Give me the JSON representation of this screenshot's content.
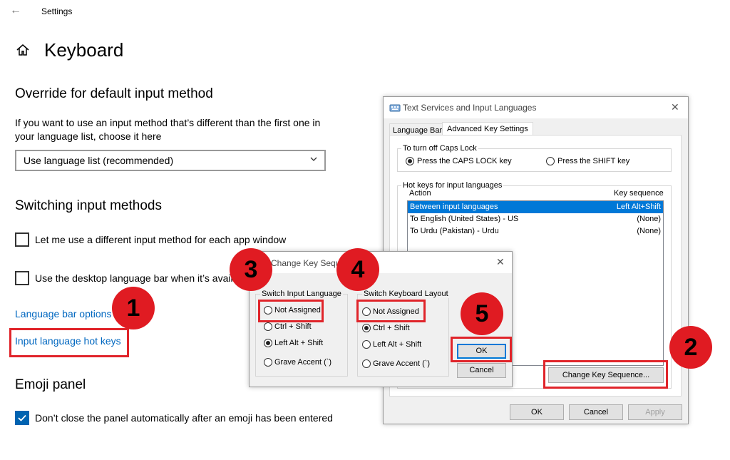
{
  "window": {
    "back_icon": "back-arrow-icon",
    "title": "Settings"
  },
  "page": {
    "title": "Keyboard",
    "home_icon": "home-icon"
  },
  "override": {
    "heading": "Override for default input method",
    "description_line1": "If you want to use an input method that’s different than the first one in",
    "description_line2": "your language list, choose it here",
    "dropdown_value": "Use language list (recommended)"
  },
  "switching": {
    "heading": "Switching input methods",
    "option1": "Let me use a different input method for each app window",
    "option2": "Use the desktop language bar when it’s available",
    "link_language_bar": "Language bar options",
    "link_hotkeys": "Input language hot keys"
  },
  "emoji": {
    "heading": "Emoji panel",
    "option": "Don’t close the panel automatically after an emoji has been entered"
  },
  "tsil": {
    "title": "Text Services and Input Languages",
    "close": "✕",
    "tabs": [
      "Language Bar",
      "Advanced Key Settings"
    ],
    "caps_group": "To turn off Caps Lock",
    "caps_opt1": "Press the CAPS LOCK key",
    "caps_opt2": "Press the SHIFT key",
    "hotkeys_group": "Hot keys for input languages",
    "col_action": "Action",
    "col_sequence": "Key sequence",
    "rows": [
      {
        "action": "Between input languages",
        "sequence": "Left Alt+Shift"
      },
      {
        "action": "To English (United States) - US",
        "sequence": "(None)"
      },
      {
        "action": "To Urdu (Pakistan) - Urdu",
        "sequence": "(None)"
      }
    ],
    "change_btn": "Change Key Sequence...",
    "ok": "OK",
    "cancel": "Cancel",
    "apply": "Apply"
  },
  "cks": {
    "title": "Change Key Seque",
    "close": "✕",
    "input_group": "Switch Input Language",
    "input_opts": [
      "Not Assigned",
      "Ctrl + Shift",
      "Left Alt + Shift",
      "Grave Accent (`)"
    ],
    "layout_group": "Switch Keyboard Layout",
    "layout_opts": [
      "Not Assigned",
      "Ctrl + Shift",
      "Left Alt + Shift",
      "Grave Accent (`)"
    ],
    "ok": "OK",
    "cancel": "Cancel"
  },
  "badges": [
    "1",
    "2",
    "3",
    "4",
    "5"
  ],
  "colors": {
    "accent": "#0078d7",
    "link": "#0067c0",
    "annotation_red": "#e0242a"
  }
}
